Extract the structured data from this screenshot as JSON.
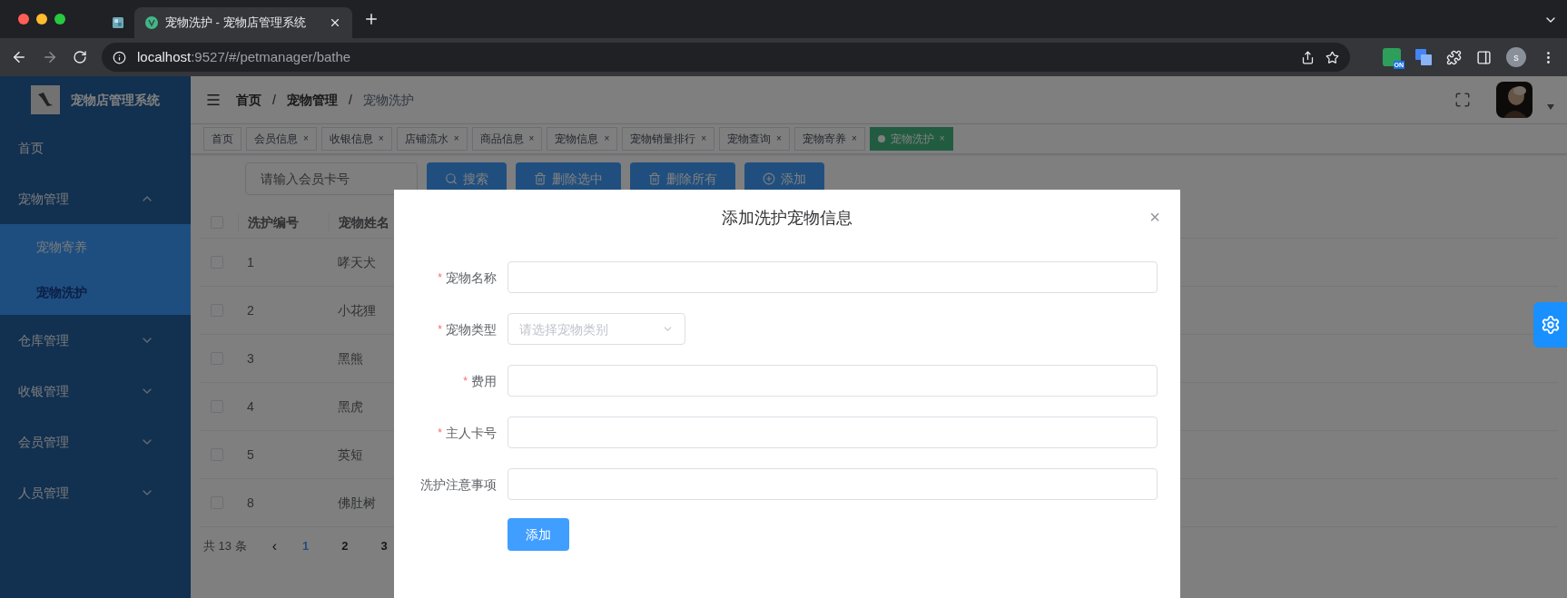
{
  "browser": {
    "tabs": [
      {
        "selected": false
      },
      {
        "title": "宠物洗护 - 宠物店管理系统",
        "selected": true
      }
    ],
    "url_host": "localhost",
    "url_path": ":9527/#/petmanager/bathe",
    "extension_badge": "ON",
    "profile_initial": "s"
  },
  "app": {
    "logo_title": "宠物店管理系统",
    "sidebar": [
      {
        "label": "首页"
      },
      {
        "label": "宠物管理",
        "expanded": true,
        "children": [
          {
            "label": "宠物寄养",
            "selected": false
          },
          {
            "label": "宠物洗护",
            "selected": true
          }
        ]
      },
      {
        "label": "仓库管理",
        "expanded": false
      },
      {
        "label": "收银管理",
        "expanded": false
      },
      {
        "label": "会员管理",
        "expanded": false
      },
      {
        "label": "人员管理",
        "expanded": false
      }
    ],
    "breadcrumbs": [
      "首页",
      "宠物管理",
      "宠物洗护"
    ],
    "breadcrumb_separator": "/",
    "tags": [
      {
        "label": "首页",
        "closable": false,
        "selected": false
      },
      {
        "label": "会员信息",
        "closable": true,
        "selected": false
      },
      {
        "label": "收银信息",
        "closable": true,
        "selected": false
      },
      {
        "label": "店铺流水",
        "closable": true,
        "selected": false
      },
      {
        "label": "商品信息",
        "closable": true,
        "selected": false
      },
      {
        "label": "宠物信息",
        "closable": true,
        "selected": false
      },
      {
        "label": "宠物销量排行",
        "closable": true,
        "selected": false
      },
      {
        "label": "宠物查询",
        "closable": true,
        "selected": false
      },
      {
        "label": "宠物寄养",
        "closable": true,
        "selected": false
      },
      {
        "label": "宠物洗护",
        "closable": true,
        "selected": true
      }
    ],
    "close_mark": "×",
    "search": {
      "placeholder": "请输入会员卡号"
    },
    "toolbar": [
      {
        "label": "搜索",
        "kind": "search"
      },
      {
        "label": "删除选中",
        "kind": "delete"
      },
      {
        "label": "删除所有",
        "kind": "delete"
      },
      {
        "label": "添加",
        "kind": "add"
      }
    ],
    "table": {
      "columns": [
        "洗护编号",
        "宠物姓名"
      ],
      "header_checked": false,
      "rows": [
        {
          "id": "1",
          "name": "哮天犬",
          "checked": false
        },
        {
          "id": "2",
          "name": "小花狸",
          "checked": false
        },
        {
          "id": "3",
          "name": "黑熊",
          "checked": false
        },
        {
          "id": "4",
          "name": "黑虎",
          "checked": false
        },
        {
          "id": "5",
          "name": "英短",
          "checked": false
        },
        {
          "id": "8",
          "name": "佛肚树",
          "checked": false
        }
      ]
    },
    "pagination": {
      "total": "共 13 条",
      "prev": "‹",
      "pages": [
        {
          "label": "1",
          "selected": true
        },
        {
          "label": "2",
          "selected": false
        },
        {
          "label": "3",
          "selected": false
        }
      ]
    },
    "dialog": {
      "title": "添加洗护宠物信息",
      "close": "×",
      "fields": [
        {
          "label": "宠物名称",
          "required": true,
          "kind": "input"
        },
        {
          "label": "宠物类型",
          "required": true,
          "kind": "select",
          "placeholder": "请选择宠物类别"
        },
        {
          "label": "费用",
          "required": true,
          "kind": "input"
        },
        {
          "label": "主人卡号",
          "required": true,
          "kind": "input"
        },
        {
          "label": "洗护注意事项",
          "required": false,
          "kind": "input"
        }
      ],
      "required_mark": "*",
      "submit": "添加"
    }
  }
}
